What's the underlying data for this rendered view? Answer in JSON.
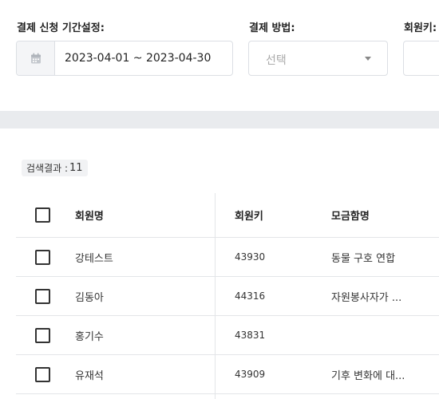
{
  "filters": {
    "period_label": "결제 신청 기간설정:",
    "date_range": "2023-04-01 ~ 2023-04-30",
    "method_label": "결제 방법:",
    "method_placeholder": "선택",
    "member_key_label": "회원키:",
    "icons": {
      "calendar": "calendar-icon",
      "dropdown": "chevron-down-icon"
    }
  },
  "results": {
    "label": "검색결과 :",
    "count": "11"
  },
  "table": {
    "headers": {
      "name": "회원명",
      "key": "회원키",
      "fund": "모금함명"
    },
    "rows": [
      {
        "name": "강테스트",
        "key": "43930",
        "fund": "동물 구호 연합"
      },
      {
        "name": "김동아",
        "key": "44316",
        "fund": "자원봉사자가 ..."
      },
      {
        "name": "홍기수",
        "key": "43831",
        "fund": ""
      },
      {
        "name": "유재석",
        "key": "43909",
        "fund": "기후 변화에 대..."
      }
    ]
  }
}
